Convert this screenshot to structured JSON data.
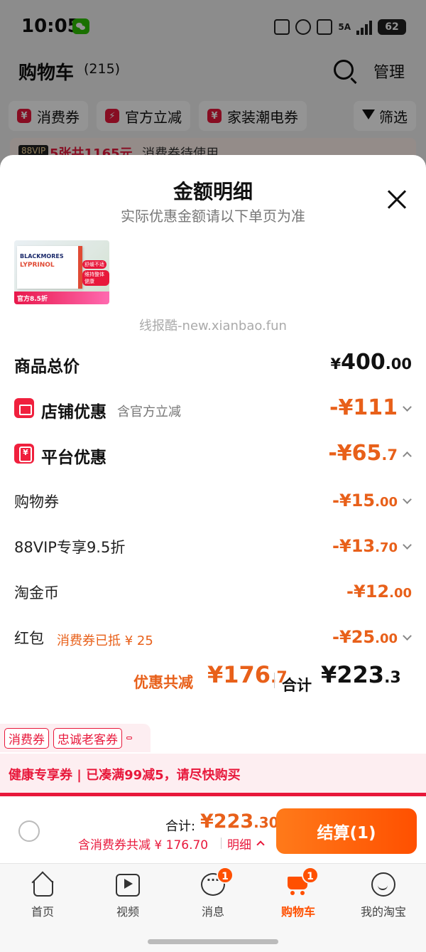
{
  "status_bar": {
    "time": "10:05",
    "network": "5A",
    "battery": "62"
  },
  "header": {
    "title": "购物车",
    "count": "(215)",
    "manage": "管理"
  },
  "filters": {
    "chips": [
      "消费券",
      "官方立减",
      "家装潮电券"
    ],
    "filter_label": "筛选"
  },
  "vip_banner": {
    "tag": "88VIP",
    "text": "5张共1165元",
    "text2": "消费券待使用"
  },
  "sheet": {
    "title": "金额明细",
    "subtitle": "实际优惠金额请以下单页为准",
    "watermark": "线报酷-new.xianbao.fun",
    "product": {
      "brand": "BLACKMORES",
      "name": "LYPRINOL",
      "pill1": "舒缓不适",
      "pill2": "维持整体健康",
      "promo": "官方8.5折"
    },
    "rows": {
      "goods_total": {
        "label": "商品总价",
        "currency": "¥",
        "int": "400",
        "dec": ".00"
      },
      "store_discount": {
        "label": "店铺优惠",
        "note": "含官方立减",
        "int": "-¥111",
        "dec": ""
      },
      "platform_discount": {
        "label": "平台优惠",
        "int": "-¥65",
        "dec": ".7"
      },
      "shopping_coupon": {
        "label": "购物券",
        "int": "-¥15",
        "dec": ".00"
      },
      "vip_discount": {
        "label": "88VIP专享9.5折",
        "int": "-¥13",
        "dec": ".70"
      },
      "tao_coins": {
        "label": "淘金币",
        "int": "-¥12",
        "dec": ".00"
      },
      "red_packet": {
        "label": "红包",
        "note": "消费券已抵 ¥ 25",
        "int": "-¥25",
        "dec": ".00"
      }
    },
    "summary": {
      "label": "优惠共减",
      "discount_int": "¥176",
      "discount_dec": ".7",
      "total_label": "合计",
      "total_int": "¥223",
      "total_dec": ".3"
    }
  },
  "coupon_tags": [
    "消费券",
    "忠诚老客券"
  ],
  "health_banner": {
    "text": "健康专享券 | 已凑满99减5，请尽快购买"
  },
  "checkout": {
    "total_label": "合计:",
    "total_int": "¥223",
    "total_dec": ".30",
    "discount_text": "含消费券共减 ¥ 176.70",
    "detail_label": "明细",
    "button": "结算(1)"
  },
  "tabs": [
    {
      "label": "首页",
      "icon": "home-icon"
    },
    {
      "label": "视频",
      "icon": "video-icon"
    },
    {
      "label": "消息",
      "icon": "message-icon",
      "badge": "1"
    },
    {
      "label": "购物车",
      "icon": "cart-icon",
      "badge": "1",
      "active": true
    },
    {
      "label": "我的淘宝",
      "icon": "profile-icon"
    }
  ],
  "colors": {
    "accent": "#ff5000",
    "discount": "#e8601a",
    "red": "#e8183b"
  }
}
